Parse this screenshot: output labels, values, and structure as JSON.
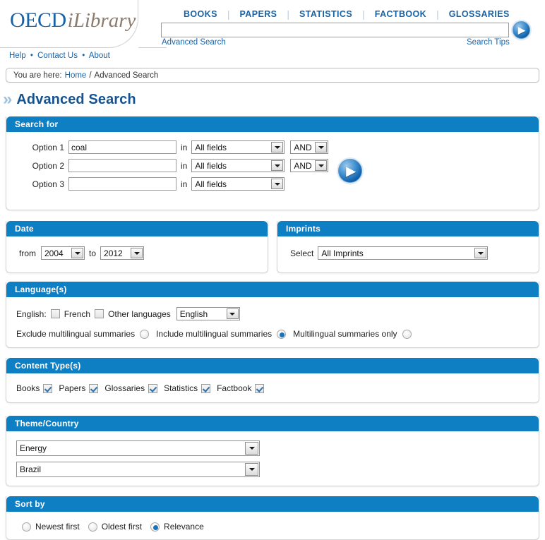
{
  "brand": {
    "primary": "OECD",
    "secondary": "iLibrary"
  },
  "topnav": {
    "items": [
      {
        "label": "BOOKS"
      },
      {
        "label": "PAPERS"
      },
      {
        "label": "STATISTICS"
      },
      {
        "label": "FACTBOOK"
      },
      {
        "label": "GLOSSARIES"
      }
    ],
    "separator": "|"
  },
  "header_search": {
    "value": "",
    "placeholder": "",
    "advanced_search_link": "Advanced Search",
    "search_tips_link": "Search Tips",
    "submit_icon": "▶"
  },
  "utility": {
    "help": "Help",
    "contact": "Contact Us",
    "about": "About",
    "dot": "•"
  },
  "breadcrumb": {
    "prefix": "You are here:",
    "home": "Home",
    "sep": "/",
    "current": "Advanced Search"
  },
  "page": {
    "chevron": "»",
    "title": "Advanced Search"
  },
  "search_for": {
    "heading": "Search for",
    "in_label": "in",
    "submit_icon": "▶",
    "rows": [
      {
        "option_label": "Option 1",
        "value": "coal",
        "field": "All fields",
        "operator": "AND",
        "has_operator": true
      },
      {
        "option_label": "Option 2",
        "value": "",
        "field": "All fields",
        "operator": "AND",
        "has_operator": true
      },
      {
        "option_label": "Option 3",
        "value": "",
        "field": "All fields",
        "operator": "",
        "has_operator": false
      }
    ]
  },
  "date": {
    "heading": "Date",
    "from_label": "from",
    "to_label": "to",
    "from_value": "2004",
    "to_value": "2012"
  },
  "imprints": {
    "heading": "Imprints",
    "select_label": "Select",
    "value": "All Imprints"
  },
  "languages": {
    "heading": "Language(s)",
    "english_label": "English:",
    "english_checked": false,
    "french_label": "French",
    "french_checked": false,
    "other_label": "Other languages",
    "other_value": "English",
    "summaries": [
      {
        "label": "Exclude multilingual summaries",
        "selected": false
      },
      {
        "label": "Include multilingual summaries",
        "selected": true
      },
      {
        "label": "Multilingual summaries only",
        "selected": false
      }
    ]
  },
  "content_types": {
    "heading": "Content Type(s)",
    "items": [
      {
        "label": "Books",
        "checked": true
      },
      {
        "label": "Papers",
        "checked": true
      },
      {
        "label": "Glossaries",
        "checked": true
      },
      {
        "label": "Statistics",
        "checked": true
      },
      {
        "label": "Factbook",
        "checked": true
      }
    ]
  },
  "theme_country": {
    "heading": "Theme/Country",
    "theme_value": "Energy",
    "country_value": "Brazil"
  },
  "sort_by": {
    "heading": "Sort by",
    "options": [
      {
        "label": "Newest first",
        "selected": false
      },
      {
        "label": "Oldest first",
        "selected": false
      },
      {
        "label": "Relevance",
        "selected": true
      }
    ]
  },
  "colors": {
    "panel_header": "#0f7fc4",
    "link": "#1763a8",
    "title": "#14538f",
    "brand_blue": "#1763a8",
    "brand_brown": "#8b7b6b",
    "radio_dot": "#1673bd"
  }
}
